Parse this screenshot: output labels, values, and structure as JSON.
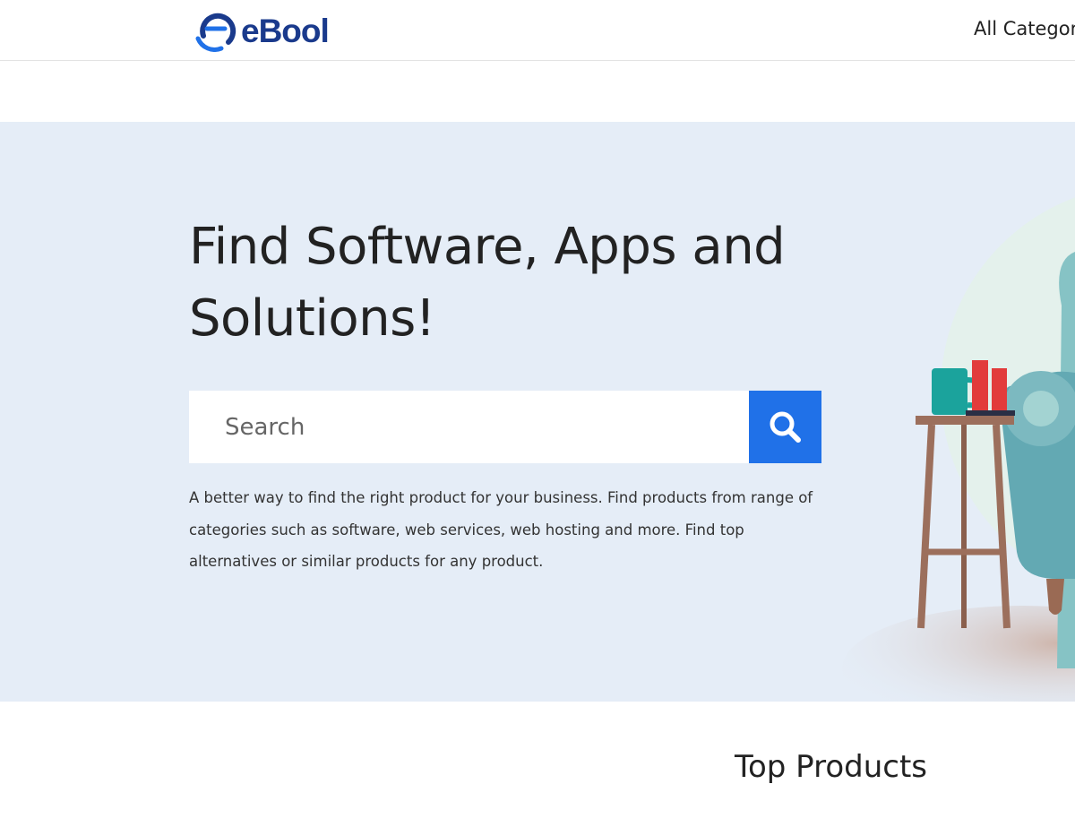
{
  "header": {
    "logo_text": "eBool",
    "nav_link": "All Categories",
    "logo_icon": "ebool-logo-mark",
    "brand_color": "#1a3a8c",
    "accent_color": "#2071e8"
  },
  "hero": {
    "title": "Find Software, Apps and Solutions!",
    "search": {
      "placeholder": "Search",
      "value": "",
      "button_icon": "search-icon"
    },
    "description": "A better way to find the right product for your business. Find products from range of categories such as software, web services, web hosting and more. Find top alternatives or similar products for any product.",
    "background_color": "#e5edf7"
  },
  "sections": {
    "top_products_title": "Top Products"
  }
}
